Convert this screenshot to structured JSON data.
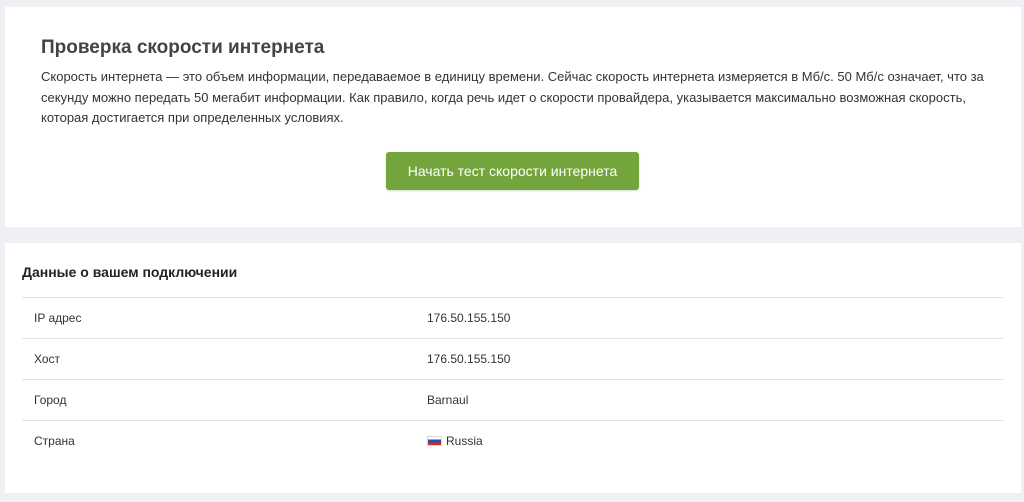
{
  "speedtest": {
    "title": "Проверка скорости интернета",
    "description": "Скорость интернета — это объем информации, передаваемое в единицу времени. Сейчас скорость интернета измеряется в Мб/с. 50 Мб/с означает, что за секунду можно передать 50 мегабит информации. Как правило, когда речь идет о скорости провайдера, указывается максимально возможная скорость, которая достигается при определенных условиях.",
    "start_button_label": "Начать тест скорости интернета",
    "accent_color": "#74a53c"
  },
  "connection": {
    "title": "Данные о вашем подключении",
    "rows": [
      {
        "label": "IP адрес",
        "value": "176.50.155.150"
      },
      {
        "label": "Хост",
        "value": "176.50.155.150"
      },
      {
        "label": "Город",
        "value": "Barnaul"
      },
      {
        "label": "Страна",
        "value": "Russia",
        "icon": "russia-flag-icon"
      }
    ]
  }
}
